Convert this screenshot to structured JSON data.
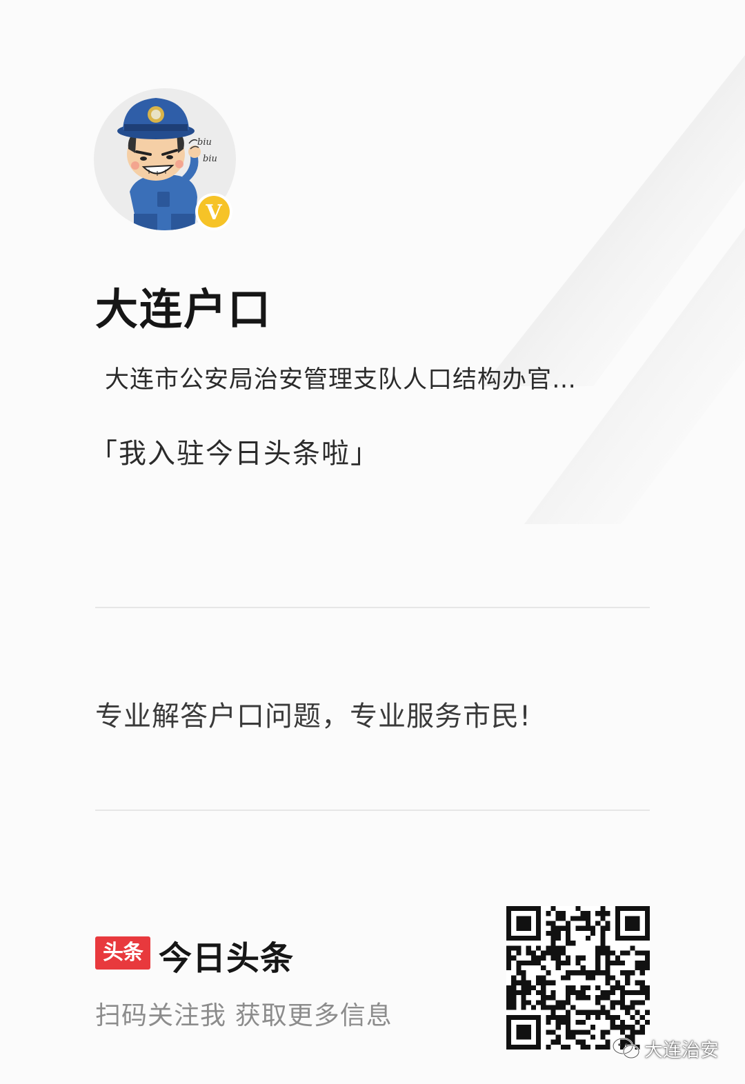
{
  "profile": {
    "name": "大连户口",
    "description": "大连市公安局治安管理支队人口结构办官…",
    "announcement": "「我入驻今日头条啦」",
    "verified_badge_letter": "V",
    "avatar_text": {
      "biu_1": "biu",
      "biu_2": "biu"
    },
    "avatar_icon": "police-cartoon-avatar",
    "badge_icon": "verified-v-badge"
  },
  "slogan": "专业解答户口问题，专业服务市民!",
  "footer": {
    "logo_text": "头条",
    "brand_name": "今日头条",
    "scan_hint": "扫码关注我 获取更多信息",
    "qr_icon": "qr-code"
  },
  "watermark": {
    "text": "大连治安",
    "icon": "wechat-icon"
  },
  "colors": {
    "background": "#fbfbfb",
    "brand_red": "#e8393d",
    "badge_yellow": "#f6c327",
    "police_blue": "#2f5ea8",
    "hint_gray": "#8c8c8c"
  }
}
